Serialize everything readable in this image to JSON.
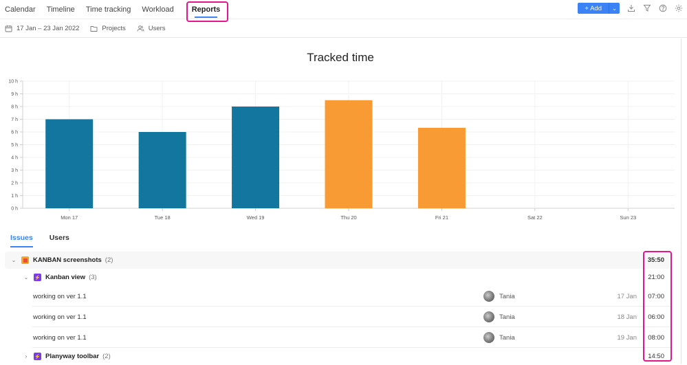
{
  "nav": {
    "tabs": [
      {
        "label": "Calendar",
        "active": false
      },
      {
        "label": "Timeline",
        "active": false
      },
      {
        "label": "Time tracking",
        "active": false
      },
      {
        "label": "Workload",
        "active": false
      },
      {
        "label": "Reports",
        "active": true
      }
    ],
    "add_label": "+ Add",
    "add_dropdown_icon": "chevron-down",
    "tools": [
      "download-icon",
      "filter-icon",
      "help-icon",
      "settings-icon"
    ]
  },
  "filters": {
    "date_range": "17 Jan – 23 Jan 2022",
    "projects": "Projects",
    "users": "Users"
  },
  "chart_data": {
    "type": "bar",
    "title": "Tracked time",
    "categories": [
      "Mon 17",
      "Tue 18",
      "Wed 19",
      "Thu 20",
      "Fri 21",
      "Sat 22",
      "Sun 23"
    ],
    "values": [
      7,
      6,
      8,
      8.5,
      6.33,
      0,
      0
    ],
    "colors": [
      "#12769e",
      "#12769e",
      "#12769e",
      "#f89b34",
      "#f89b34",
      "#12769e",
      "#12769e"
    ],
    "yticks": [
      "0 h",
      "1 h",
      "2 h",
      "3 h",
      "4 h",
      "5 h",
      "6 h",
      "7 h",
      "8 h",
      "9 h",
      "10 h"
    ],
    "ylim": [
      0,
      10
    ],
    "xlabel": "",
    "ylabel": "",
    "grid": true
  },
  "report": {
    "tabs": [
      {
        "label": "Issues",
        "active": true
      },
      {
        "label": "Users",
        "active": false
      }
    ],
    "project": {
      "name": "KANBAN screenshots",
      "count": "(2)",
      "total": "35:50"
    },
    "issues": [
      {
        "name": "Kanban view",
        "count": "(3)",
        "total": "21:00",
        "expanded": true,
        "entries": [
          {
            "description": "working on ver 1.1",
            "user": "Tania",
            "date": "17 Jan",
            "time": "07:00"
          },
          {
            "description": "working on ver 1.1",
            "user": "Tania",
            "date": "18 Jan",
            "time": "06:00"
          },
          {
            "description": "working on ver 1.1",
            "user": "Tania",
            "date": "19 Jan",
            "time": "08:00"
          }
        ]
      },
      {
        "name": "Planyway toolbar",
        "count": "(2)",
        "total": "14:50",
        "expanded": false
      }
    ]
  }
}
